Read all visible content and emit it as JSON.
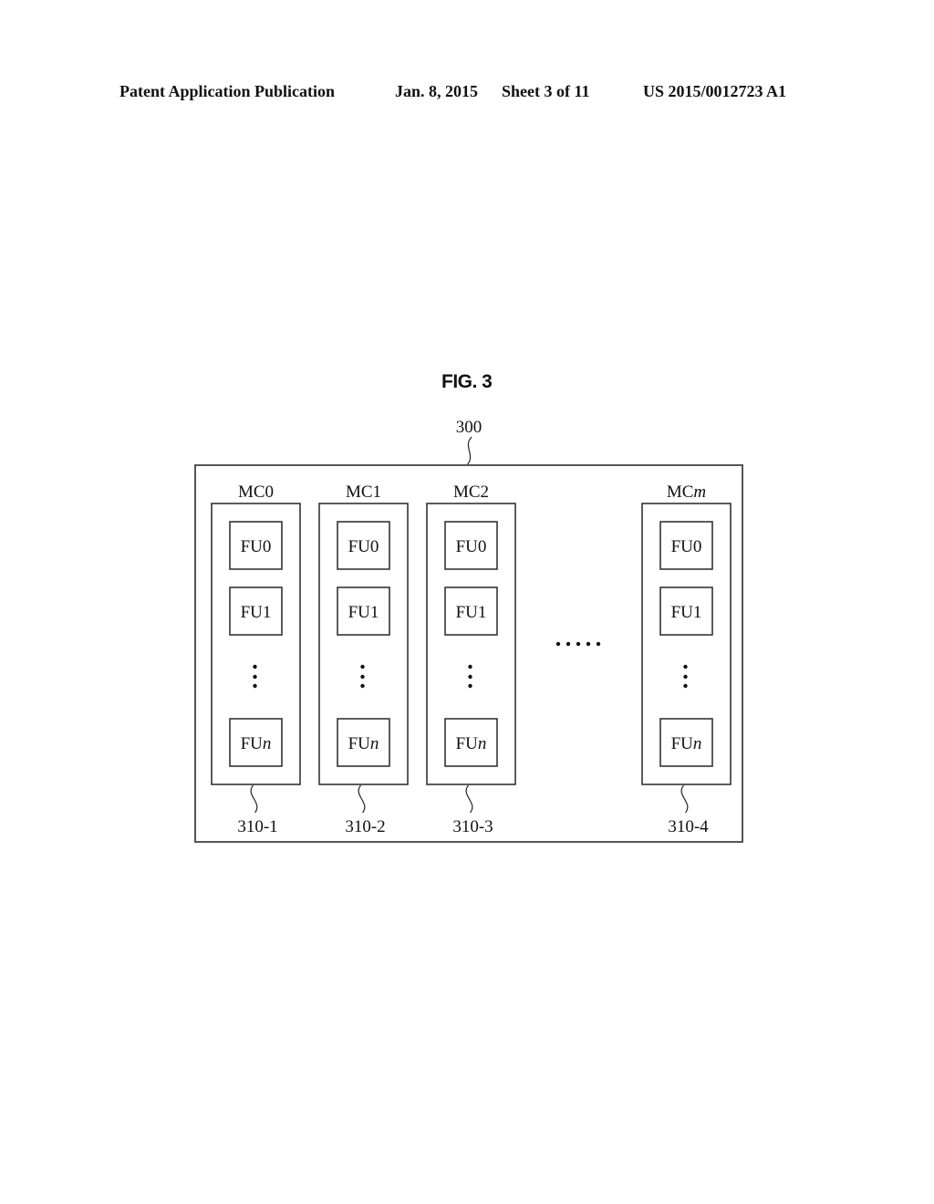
{
  "header": {
    "publication": "Patent Application Publication",
    "date": "Jan. 8, 2015",
    "sheet": "Sheet 3 of 11",
    "number": "US 2015/0012723 A1"
  },
  "figure": {
    "title": "FIG. 3",
    "outer_ref": "300",
    "columns": [
      {
        "label": "MC0",
        "ref": "310-1",
        "units": [
          "FU0",
          "FU1",
          "FUn"
        ]
      },
      {
        "label": "MC1",
        "ref": "310-2",
        "units": [
          "FU0",
          "FU1",
          "FUn"
        ]
      },
      {
        "label": "MC2",
        "ref": "310-3",
        "units": [
          "FU0",
          "FU1",
          "FUn"
        ]
      },
      {
        "label": "MCm",
        "ref": "310-4",
        "units": [
          "FU0",
          "FU1",
          "FUn"
        ]
      }
    ],
    "column_label_prefix": "MC",
    "unit_label_prefix": "FU",
    "ellipsis_between_columns": ".....",
    "ellipsis_between_units": "vertical-dots"
  }
}
